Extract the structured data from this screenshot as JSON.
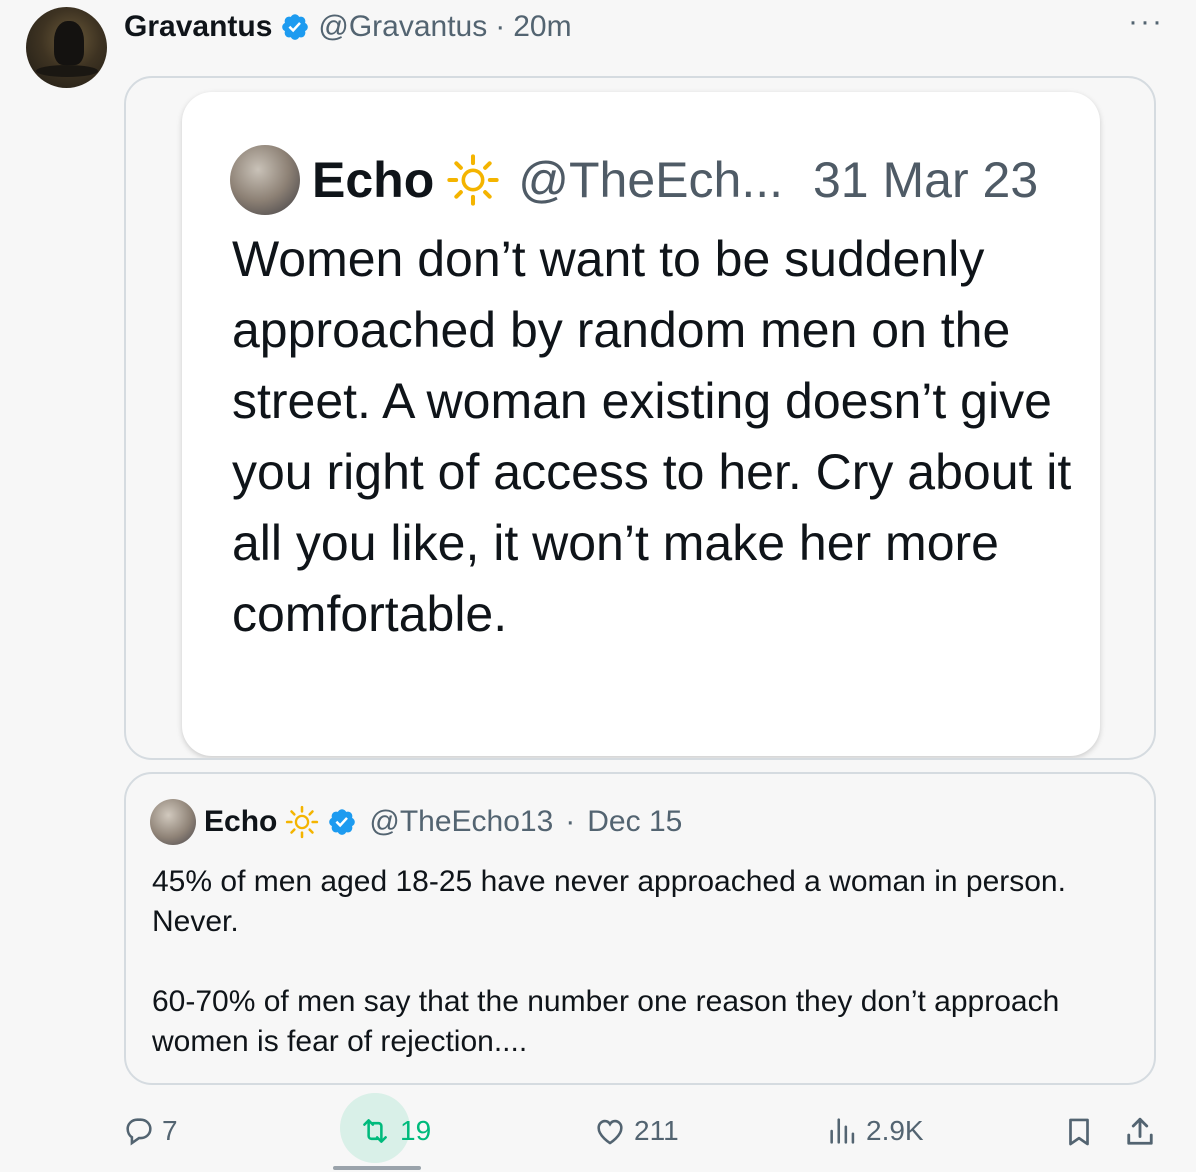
{
  "post": {
    "author_name": "Gravantus",
    "author_handle": "@Gravantus",
    "separator": "·",
    "time": "20m",
    "more_label": "···"
  },
  "embedded_screenshot": {
    "name": "Echo",
    "handle": "@TheEch...",
    "date": "31 Mar 23",
    "text": "Women don’t want to be suddenly approached by random men on the street. A woman existing doesn’t give you right of access to her. Cry about it all you like, it won’t make her more comfortable."
  },
  "quoted_post": {
    "name": "Echo",
    "handle": "@TheEcho13",
    "separator": "·",
    "date": "Dec 15",
    "paragraph1_line1": "45% of men aged 18-25 have never approached a woman in person.",
    "paragraph1_line2": "Never.",
    "paragraph2": "60-70% of men say that the number one reason they don’t approach women is fear of rejection...."
  },
  "actions": {
    "replies": "7",
    "reposts": "19",
    "likes": "211",
    "views": "2.9K"
  },
  "colors": {
    "verified": "#1d9bf0",
    "repost_active": "#00ba7c",
    "secondary_text": "#536471",
    "sun_icon": "#f4b400"
  },
  "icons": [
    "verified-badge-icon",
    "sun-icon",
    "more-icon",
    "reply-icon",
    "repost-icon",
    "like-icon",
    "views-icon",
    "bookmark-icon",
    "share-icon"
  ]
}
